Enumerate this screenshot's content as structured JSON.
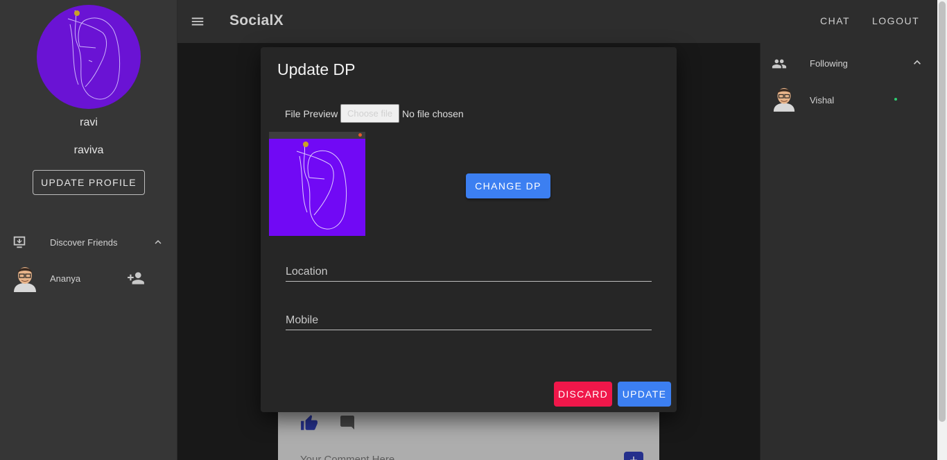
{
  "app": {
    "brand": "SocialX"
  },
  "nav": {
    "chat": "CHAT",
    "logout": "LOGOUT"
  },
  "profile": {
    "name": "ravi",
    "handle": "raviva",
    "update_button": "UPDATE PROFILE",
    "avatar_color": "#6a13d4"
  },
  "discover": {
    "title": "Discover Friends",
    "icon": "discover-icon",
    "friends": [
      {
        "name": "Ananya",
        "action_icon": "person-add-icon"
      }
    ]
  },
  "following": {
    "title": "Following",
    "icon": "group-icon",
    "users": [
      {
        "name": "Vishal",
        "online": true
      }
    ]
  },
  "dialog": {
    "title": "Update DP",
    "file_label": "File Preview",
    "file_button": "Choose file",
    "file_status": "No file chosen",
    "change_dp": "CHANGE DP",
    "location_placeholder": "Location",
    "mobile_placeholder": "Mobile",
    "discard": "DISCARD",
    "update": "UPDATE"
  },
  "post": {
    "comment_placeholder": "Your Comment Here",
    "add_label": "+"
  },
  "colors": {
    "primary": "#3c7ff1",
    "danger": "#f0174a",
    "sidebar": "#363636",
    "topbar": "#2d2d2d",
    "dialog": "#262626"
  }
}
